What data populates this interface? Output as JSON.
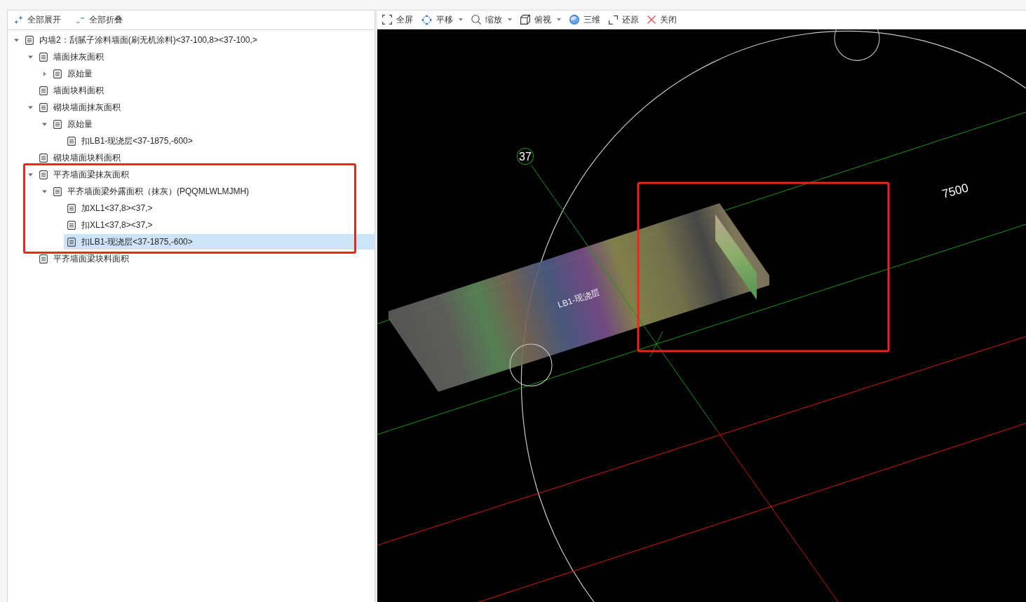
{
  "left_toolbar": [
    {
      "label": "全部展开",
      "kind": "expand"
    },
    {
      "label": "全部折叠",
      "kind": "collapse"
    }
  ],
  "tree": [
    {
      "label": "内墙2：刮腻子涂料墙面(刷无机涂料)<37-100,8><37-100,>",
      "expanded": true,
      "selected": false,
      "children": [
        {
          "label": "墙面抹灰面积",
          "expanded": true,
          "selected": false,
          "children": [
            {
              "label": "原始量",
              "expanded": false,
              "selected": false
            }
          ]
        },
        {
          "label": "墙面块料面积",
          "selected": false
        },
        {
          "label": "砌块墙面抹灰面积",
          "expanded": true,
          "selected": false,
          "children": [
            {
              "label": "原始量",
              "expanded": true,
              "selected": false,
              "children": [
                {
                  "label": "扣LB1-现浇层<37-1875,-600>",
                  "selected": false
                }
              ]
            }
          ]
        },
        {
          "label": "砌块墙面块料面积",
          "selected": false
        },
        {
          "label": "平齐墙面梁抹灰面积",
          "expanded": true,
          "selected": false,
          "children": [
            {
              "label": "平齐墙面梁外露面积（抹灰）(PQQMLWLMJMH)",
              "expanded": true,
              "selected": false,
              "children": [
                {
                  "label": "加XL1<37,8><37,>",
                  "selected": false
                },
                {
                  "label": "扣XL1<37,8><37,>",
                  "selected": false
                },
                {
                  "label": "扣LB1-现浇层<37-1875,-600>",
                  "selected": true
                }
              ]
            }
          ]
        },
        {
          "label": "平齐墙面梁块料面积",
          "selected": false
        }
      ]
    }
  ],
  "view_toolbar": [
    {
      "label": "全屏",
      "kind": "fullscreen",
      "dropdown": false
    },
    {
      "label": "平移",
      "kind": "pan",
      "dropdown": true
    },
    {
      "label": "缩放",
      "kind": "zoom",
      "dropdown": true
    },
    {
      "label": "俯视",
      "kind": "topview",
      "dropdown": true
    },
    {
      "label": "三维",
      "kind": "orbit",
      "dropdown": false
    },
    {
      "label": "还原",
      "kind": "restore",
      "dropdown": false
    },
    {
      "label": "关闭",
      "kind": "close",
      "dropdown": false
    }
  ],
  "viewport": {
    "axis_label": "37",
    "slab_label": "LB1-现浇层",
    "dimension": "7500"
  }
}
